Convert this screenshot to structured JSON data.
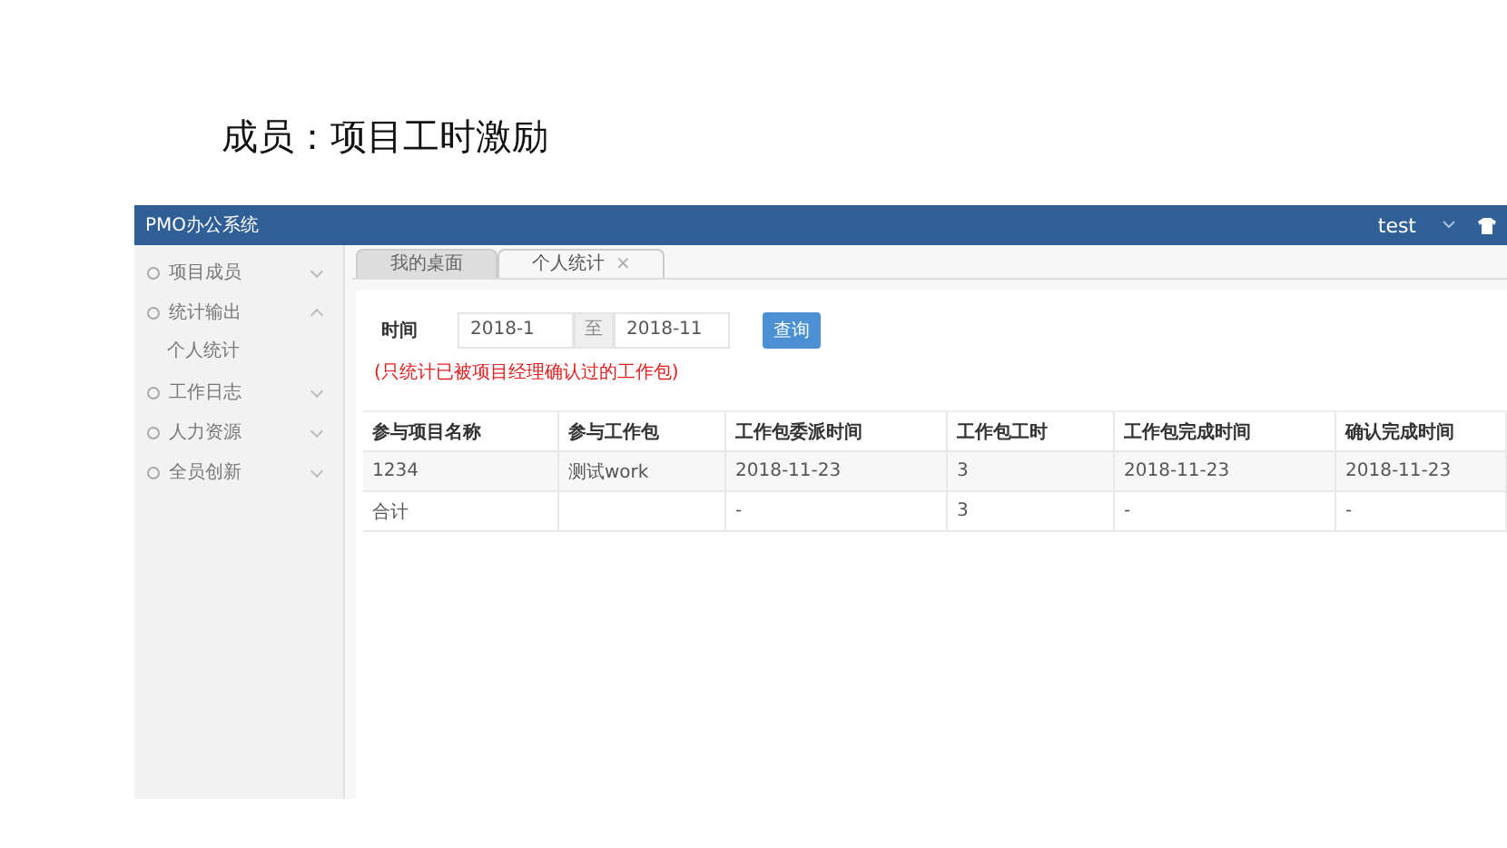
{
  "slide_title": "成员：项目工时激励",
  "window": {
    "title": "PMO办公系统",
    "user": "test"
  },
  "sidebar": {
    "items": [
      {
        "label": "项目成员",
        "expanded": false
      },
      {
        "label": "统计输出",
        "expanded": true,
        "children": [
          {
            "label": "个人统计"
          }
        ]
      },
      {
        "label": "工作日志",
        "expanded": false
      },
      {
        "label": "人力资源",
        "expanded": false
      },
      {
        "label": "全员创新",
        "expanded": false
      }
    ]
  },
  "tabs": [
    {
      "label": "我的桌面",
      "selected": false
    },
    {
      "label": "个人统计",
      "selected": true,
      "close": "×"
    }
  ],
  "filter": {
    "label": "时间",
    "from": "2018-1",
    "separator": "至",
    "to": "2018-11",
    "button": "查询",
    "note": "(只统计已被项目经理确认过的工作包)"
  },
  "table": {
    "columns": [
      "参与项目名称",
      "参与工作包",
      "工作包委派时间",
      "工作包工时",
      "工作包完成时间",
      "确认完成时间"
    ],
    "rows": [
      {
        "cells": [
          "1234",
          "测试work",
          "2018-11-23",
          "3",
          "2018-11-23",
          "2018-11-23"
        ]
      },
      {
        "cells": [
          "合计",
          null,
          "-",
          "3",
          "-",
          "-"
        ]
      }
    ]
  }
}
